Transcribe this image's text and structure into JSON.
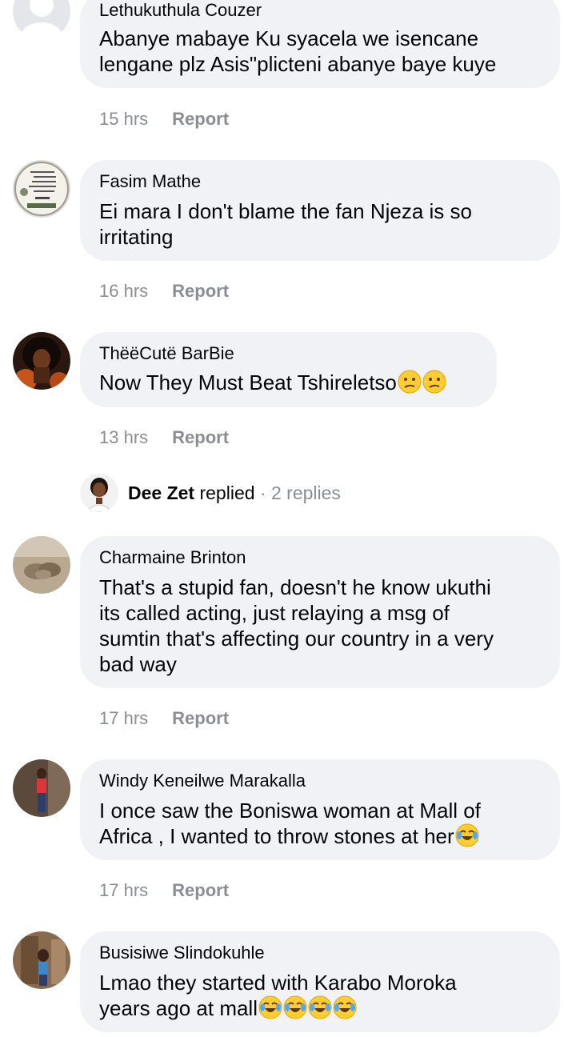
{
  "comments": [
    {
      "author": "Lethukuthula Couzer",
      "text_lines": [
        "Abanye mabaye Ku syacela we isencane",
        "lengane plz Asis\"plicteni abanye baye kuye"
      ],
      "time": "15 hrs",
      "report": "Report"
    },
    {
      "author": "Fasim Mathe",
      "text_lines": [
        "Ei mara I don't blame the fan Njeza is so",
        "irritating"
      ],
      "time": "16 hrs",
      "report": "Report"
    },
    {
      "author": "ThëëCutë BarBie",
      "text_lines": [
        "Now They Must Beat Tshireletso"
      ],
      "time": "13 hrs",
      "report": "Report"
    },
    {
      "author": "Charmaine Brinton",
      "text_lines": [
        "That's a stupid fan, doesn't he know ukuthi",
        "its called acting, just relaying a msg of",
        "sumtin that's affecting our country in a very",
        "bad way"
      ],
      "time": "17 hrs",
      "report": "Report"
    },
    {
      "author": "Windy Keneilwe Marakalla",
      "text_lines": [
        "I once saw the Boniswa woman at Mall of",
        "Africa , I wanted to throw stones at her"
      ],
      "time": "17 hrs",
      "report": "Report"
    },
    {
      "author": "Busisiwe Slindokuhle",
      "text_lines": [
        "Lmao they started with Karabo Moroka",
        "years ago at mall"
      ]
    }
  ],
  "reply_summary": {
    "name": "Dee Zet",
    "action": "replied",
    "separator": "·",
    "count": "2 replies"
  },
  "colors": {
    "bubble": "#f0f2f5",
    "meta": "#8a8d91",
    "text": "#050505"
  },
  "icons": [
    "avatar-default-icon",
    "confused-face-emoji",
    "tears-of-joy-emoji"
  ]
}
